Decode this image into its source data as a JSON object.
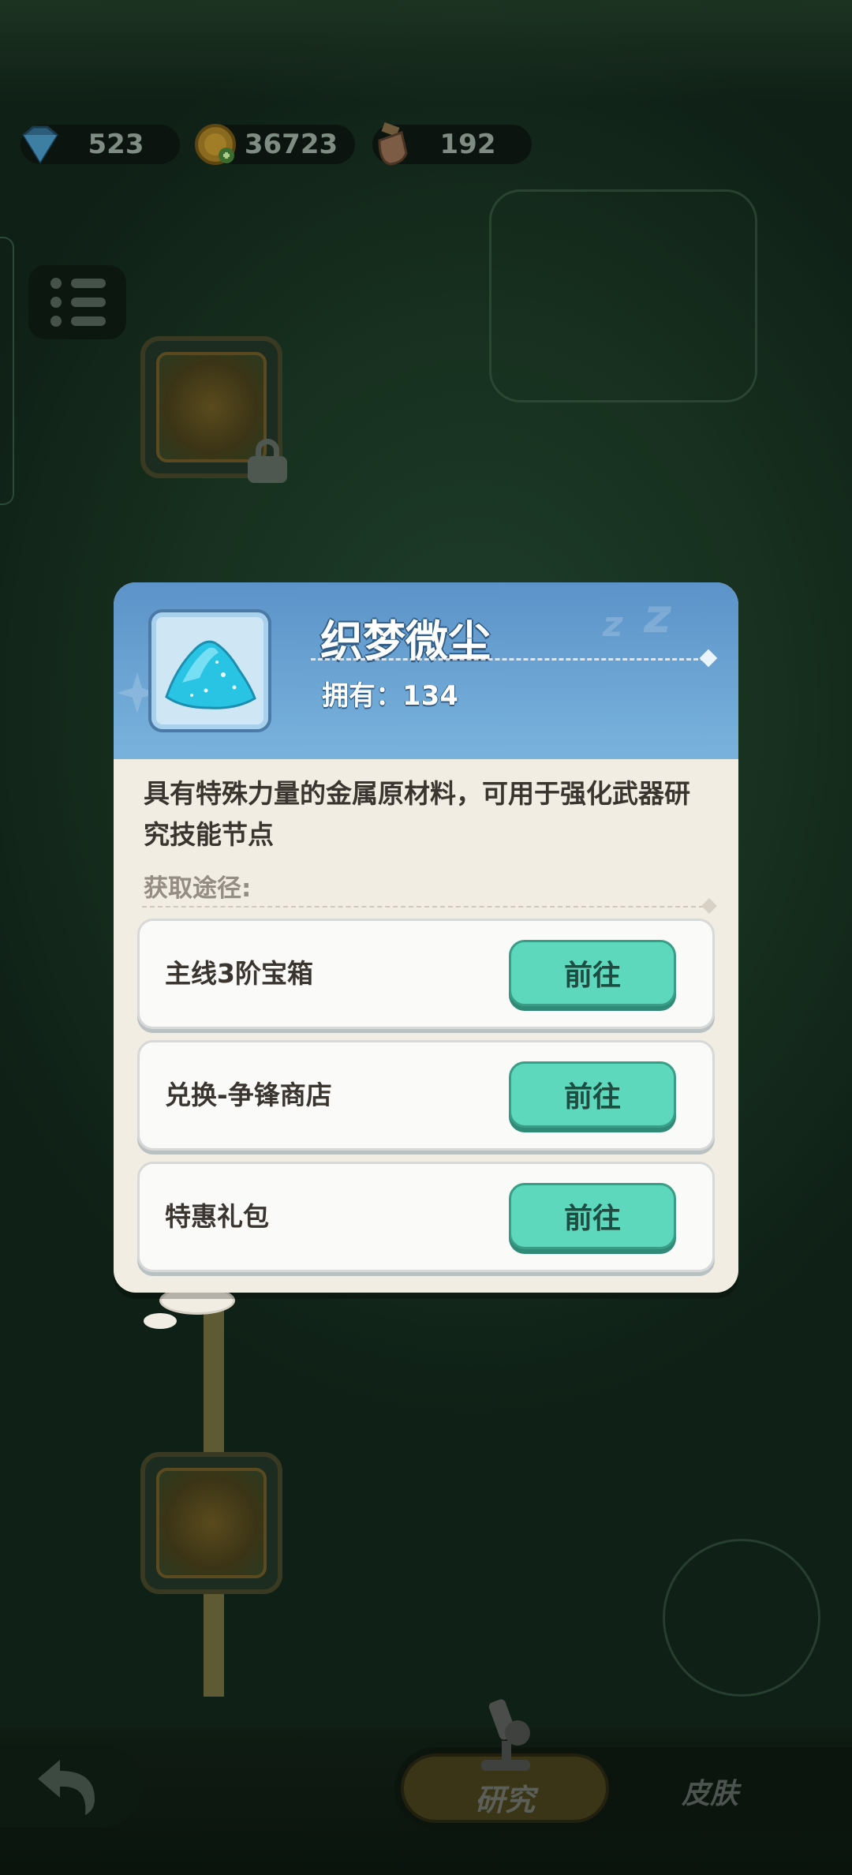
{
  "currencies": [
    {
      "name": "diamond-icon",
      "value": "523"
    },
    {
      "name": "gold-coin-icon",
      "value": "36723"
    },
    {
      "name": "energy-potion-icon",
      "value": "192"
    }
  ],
  "item": {
    "name": "织梦微尘",
    "owned": "拥有：134",
    "description": "具有特殊力量的金属原材料，可用于强化武器研究技能节点",
    "sources_label": "获取途径:",
    "sources": [
      {
        "label": "主线3阶宝箱",
        "button": "前往"
      },
      {
        "label": "兑换-争锋商店",
        "button": "前往"
      },
      {
        "label": "特惠礼包",
        "button": "前往"
      }
    ]
  },
  "bottom_tabs": {
    "research": "研究",
    "skin": "皮肤"
  },
  "colors": {
    "header_blue": "#5c93c9",
    "go_button": "#5dd8bd",
    "dialog_bg": "#f1ede2"
  }
}
